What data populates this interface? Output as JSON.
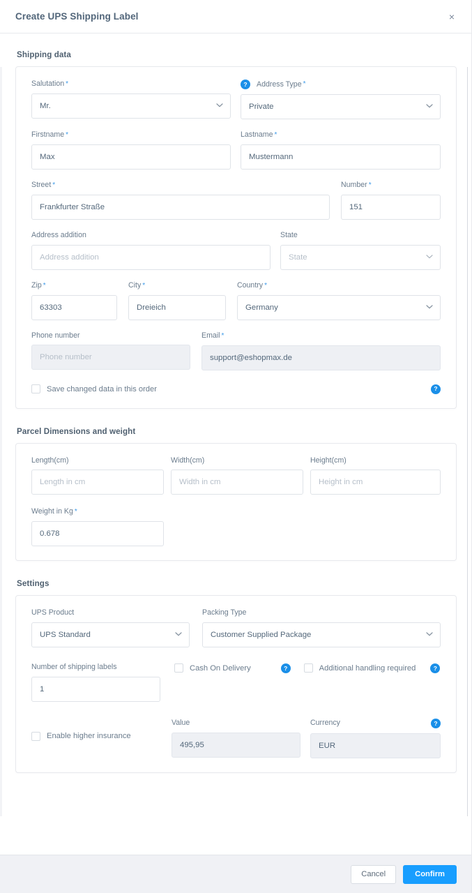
{
  "header": {
    "title": "Create UPS Shipping Label",
    "close_icon": "close-icon",
    "close_label": "×"
  },
  "shipping_data": {
    "section_title": "Shipping data",
    "salutation": {
      "label": "Salutation",
      "required": "*",
      "value": "Mr.",
      "help_icon": "help-icon",
      "help_label": "?"
    },
    "address_type": {
      "label": "Address Type",
      "required": "*",
      "value": "Private"
    },
    "firstname": {
      "label": "Firstname",
      "required": "*",
      "value": "Max"
    },
    "lastname": {
      "label": "Lastname",
      "required": "*",
      "value": "Mustermann"
    },
    "street": {
      "label": "Street",
      "required": "*",
      "value": "Frankfurter Straße"
    },
    "number": {
      "label": "Number",
      "required": "*",
      "value": "151"
    },
    "address_addition": {
      "label": "Address addition",
      "placeholder": "Address addition",
      "value": ""
    },
    "state": {
      "label": "State",
      "placeholder": "State",
      "value": ""
    },
    "zip": {
      "label": "Zip",
      "required": "*",
      "value": "63303"
    },
    "city": {
      "label": "City",
      "required": "*",
      "value": "Dreieich"
    },
    "country": {
      "label": "Country",
      "required": "*",
      "value": "Germany"
    },
    "phone": {
      "label": "Phone number",
      "placeholder": "Phone number",
      "value": ""
    },
    "email": {
      "label": "Email",
      "required": "*",
      "value": "support@eshopmax.de"
    },
    "save_checkbox": {
      "label": "Save changed data in this order",
      "checked": false
    },
    "save_help": {
      "help_label": "?"
    }
  },
  "parcel": {
    "section_title": "Parcel Dimensions and weight",
    "length": {
      "label": "Length(cm)",
      "placeholder": "Length in cm",
      "value": ""
    },
    "width": {
      "label": "Width(cm)",
      "placeholder": "Width in cm",
      "value": ""
    },
    "height": {
      "label": "Height(cm)",
      "placeholder": "Height in cm",
      "value": ""
    },
    "weight": {
      "label": "Weight in Kg",
      "required": "*",
      "value": "0.678"
    }
  },
  "settings": {
    "section_title": "Settings",
    "ups_product": {
      "label": "UPS Product",
      "value": "UPS Standard"
    },
    "packing_type": {
      "label": "Packing Type",
      "value": "Customer Supplied Package"
    },
    "number_of_labels": {
      "label": "Number of shipping labels",
      "value": "1"
    },
    "cash_on_delivery": {
      "label": "Cash On Delivery",
      "checked": false,
      "help_label": "?"
    },
    "additional_handling": {
      "label": "Additional handling required",
      "checked": false,
      "help_label": "?"
    },
    "enable_insurance": {
      "label": "Enable higher insurance",
      "checked": false
    },
    "value_field": {
      "label": "Value",
      "value": "495,95"
    },
    "currency_field": {
      "label": "Currency",
      "value": "EUR",
      "help_label": "?"
    }
  },
  "footer": {
    "cancel_label": "Cancel",
    "confirm_label": "Confirm"
  },
  "colors": {
    "accent": "#189eff",
    "help_blue": "#1a8fe8",
    "required_star": "#3e9ae8",
    "label_text": "#6b7c8d",
    "value_text": "#54687b",
    "border": "#dfe3e8",
    "footer_bg": "#f0f1f5",
    "disabled_bg": "#eef0f4"
  }
}
